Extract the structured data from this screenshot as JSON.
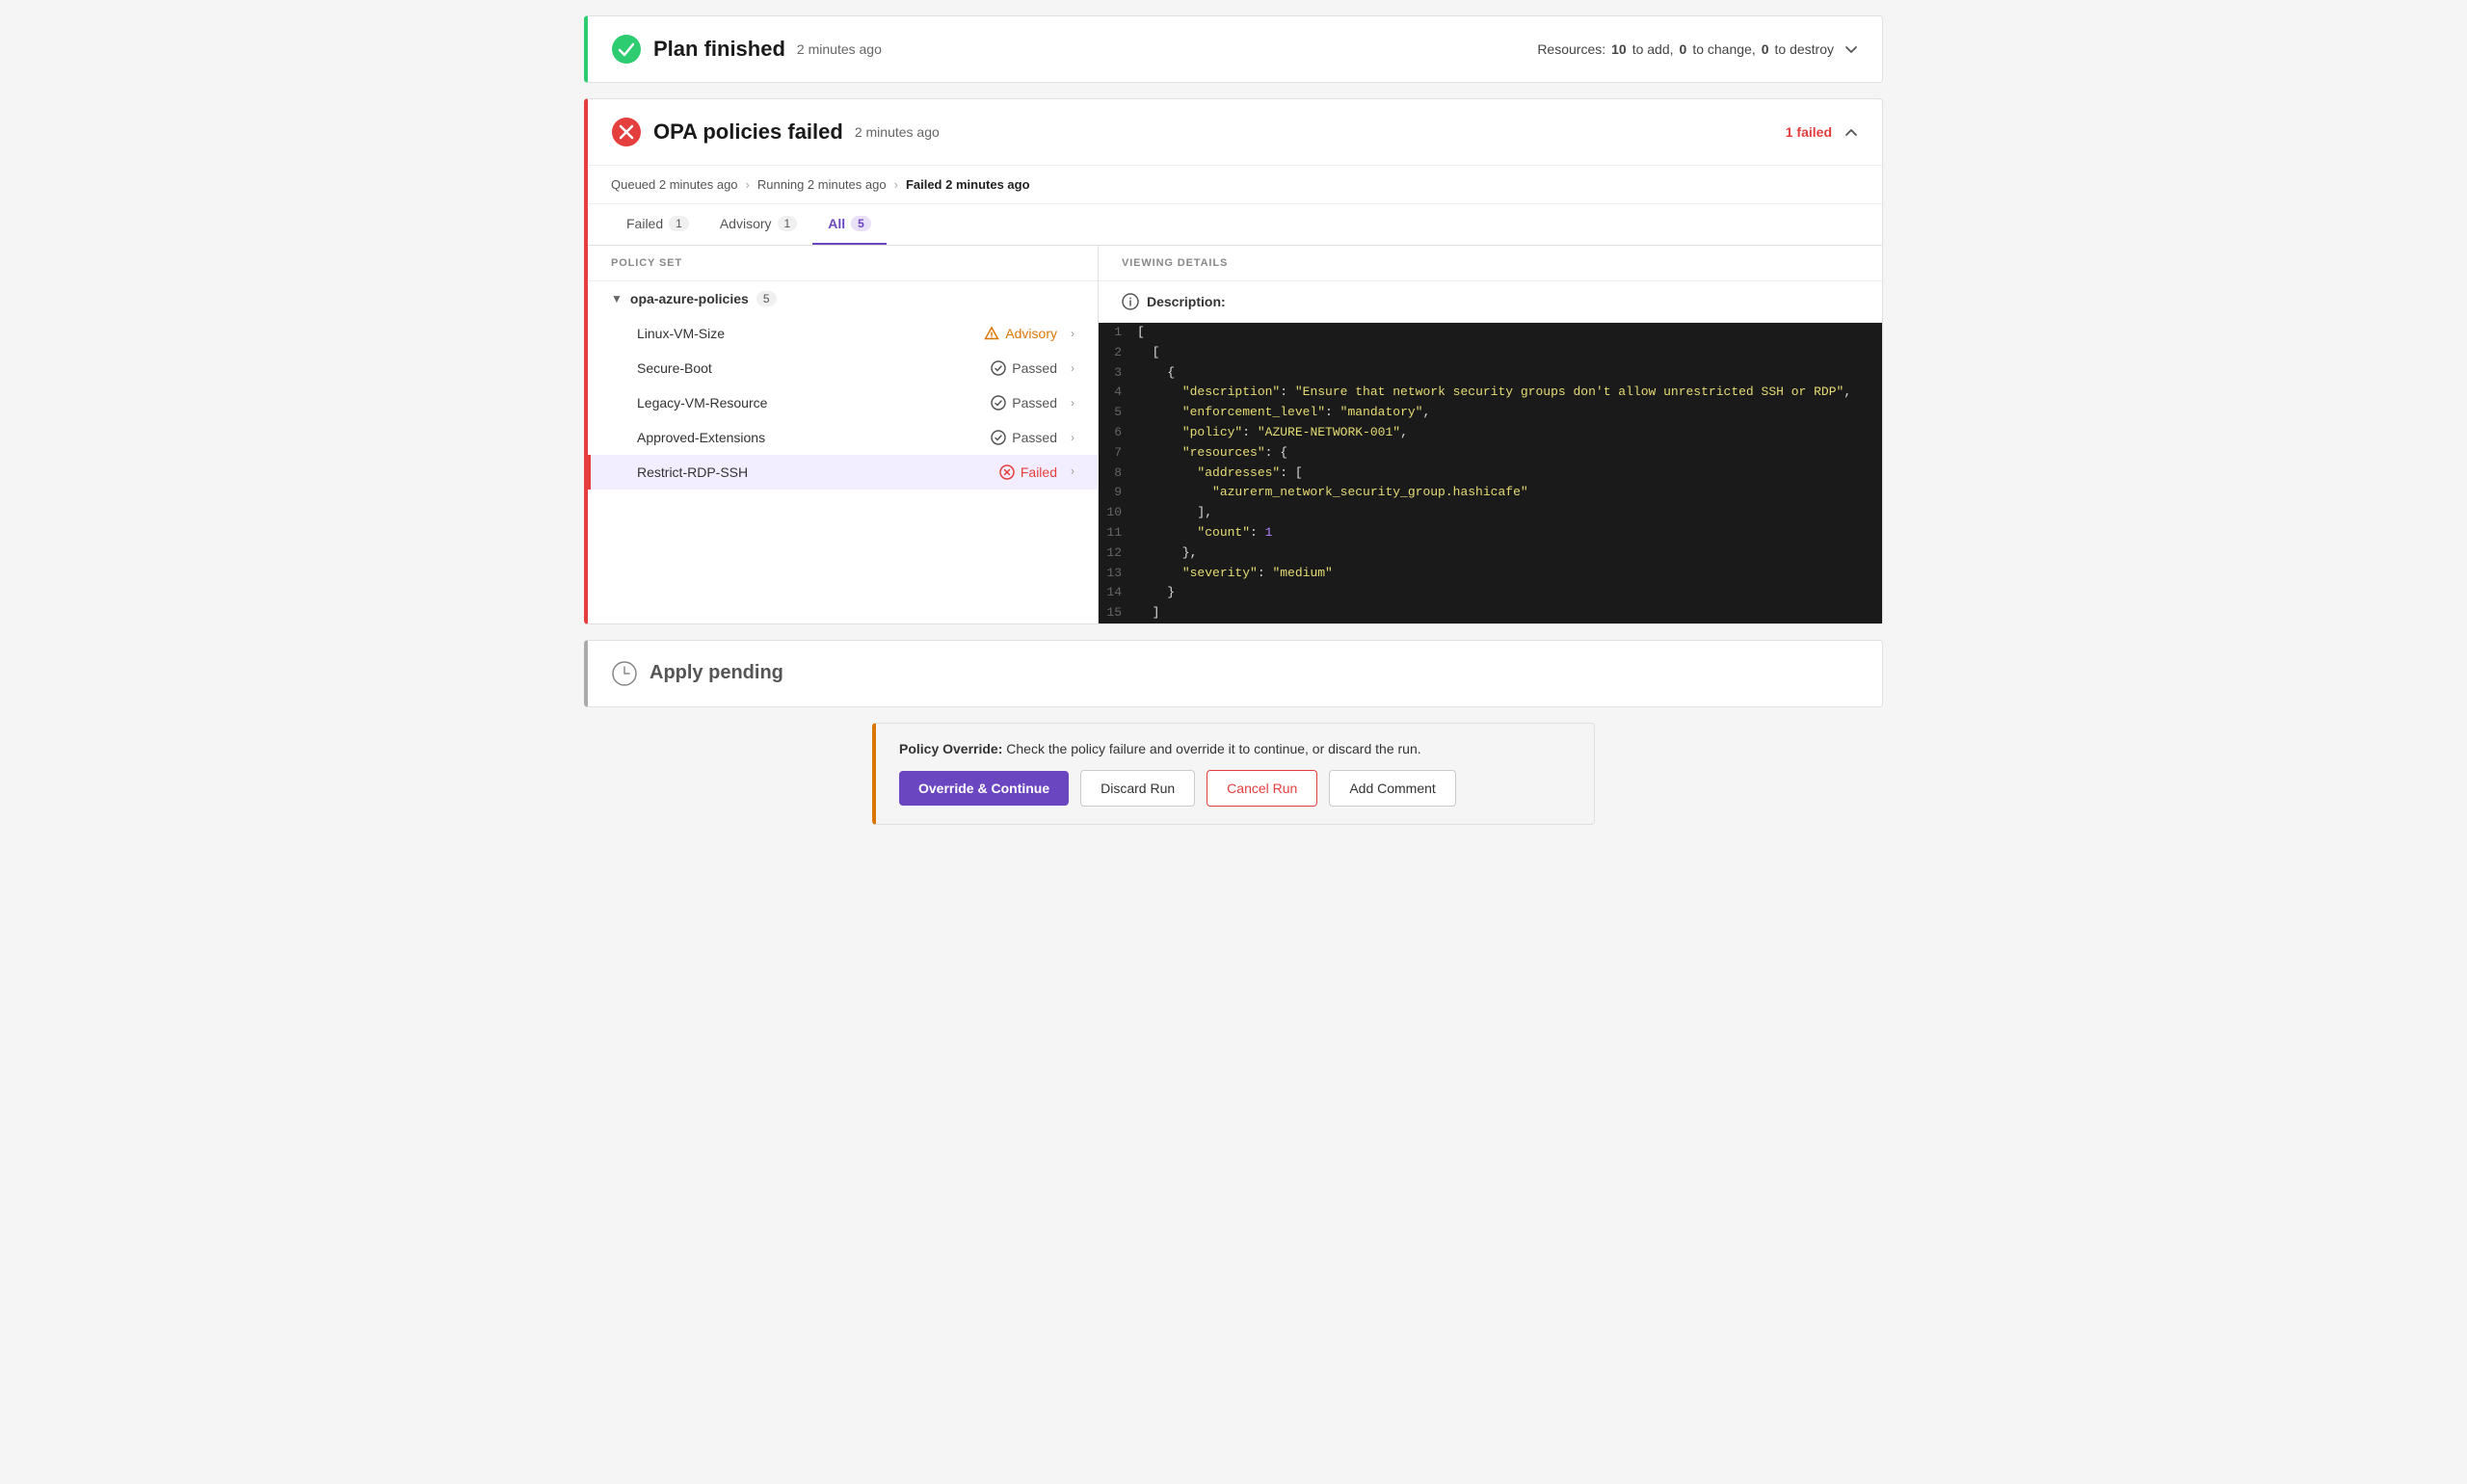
{
  "plan_finished": {
    "title": "Plan finished",
    "time": "2 minutes ago",
    "resources_label": "Resources:",
    "to_add": "10",
    "to_add_label": "to add,",
    "to_change": "0",
    "to_change_label": "to change,",
    "to_destroy": "0",
    "to_destroy_label": "to destroy"
  },
  "opa_section": {
    "title": "OPA policies failed",
    "time": "2 minutes ago",
    "failed_label": "1 failed",
    "status_queued": "Queued 2 minutes ago",
    "status_running": "Running 2 minutes ago",
    "status_failed": "Failed 2 minutes ago"
  },
  "tabs": [
    {
      "id": "failed",
      "label": "Failed",
      "badge": "1",
      "active": false
    },
    {
      "id": "advisory",
      "label": "Advisory",
      "badge": "1",
      "active": false
    },
    {
      "id": "all",
      "label": "All",
      "badge": "5",
      "active": true
    }
  ],
  "policy_panel": {
    "header": "POLICY SET",
    "set_name": "opa-azure-policies",
    "set_count": "5",
    "policies": [
      {
        "name": "Linux-VM-Size",
        "status": "Advisory",
        "type": "advisory",
        "selected": false
      },
      {
        "name": "Secure-Boot",
        "status": "Passed",
        "type": "passed",
        "selected": false
      },
      {
        "name": "Legacy-VM-Resource",
        "status": "Passed",
        "type": "passed",
        "selected": false
      },
      {
        "name": "Approved-Extensions",
        "status": "Passed",
        "type": "passed",
        "selected": false
      },
      {
        "name": "Restrict-RDP-SSH",
        "status": "Failed",
        "type": "failed",
        "selected": true
      }
    ]
  },
  "details_panel": {
    "header": "VIEWING DETAILS",
    "description_label": "Description:"
  },
  "code_lines": [
    {
      "num": "1",
      "content": "["
    },
    {
      "num": "2",
      "content": "  ["
    },
    {
      "num": "3",
      "content": "    {"
    },
    {
      "num": "4",
      "content": "      \"description\": \"Ensure that network security groups don't allow unrestricted SSH or RDP\","
    },
    {
      "num": "5",
      "content": "      \"enforcement_level\": \"mandatory\","
    },
    {
      "num": "6",
      "content": "      \"policy\": \"AZURE-NETWORK-001\","
    },
    {
      "num": "7",
      "content": "      \"resources\": {"
    },
    {
      "num": "8",
      "content": "        \"addresses\": ["
    },
    {
      "num": "9",
      "content": "          \"azurerm_network_security_group.hashicafe\""
    },
    {
      "num": "10",
      "content": "        ],"
    },
    {
      "num": "11",
      "content": "        \"count\": 1"
    },
    {
      "num": "12",
      "content": "      },"
    },
    {
      "num": "13",
      "content": "      \"severity\": \"medium\""
    },
    {
      "num": "14",
      "content": "    }"
    },
    {
      "num": "15",
      "content": "  ]"
    }
  ],
  "apply_pending": {
    "title": "Apply pending"
  },
  "action_bar": {
    "text_bold": "Policy Override:",
    "text": " Check the policy failure and override it to continue, or discard the run.",
    "btn_override": "Override & Continue",
    "btn_discard": "Discard Run",
    "btn_cancel": "Cancel Run",
    "btn_comment": "Add Comment"
  }
}
